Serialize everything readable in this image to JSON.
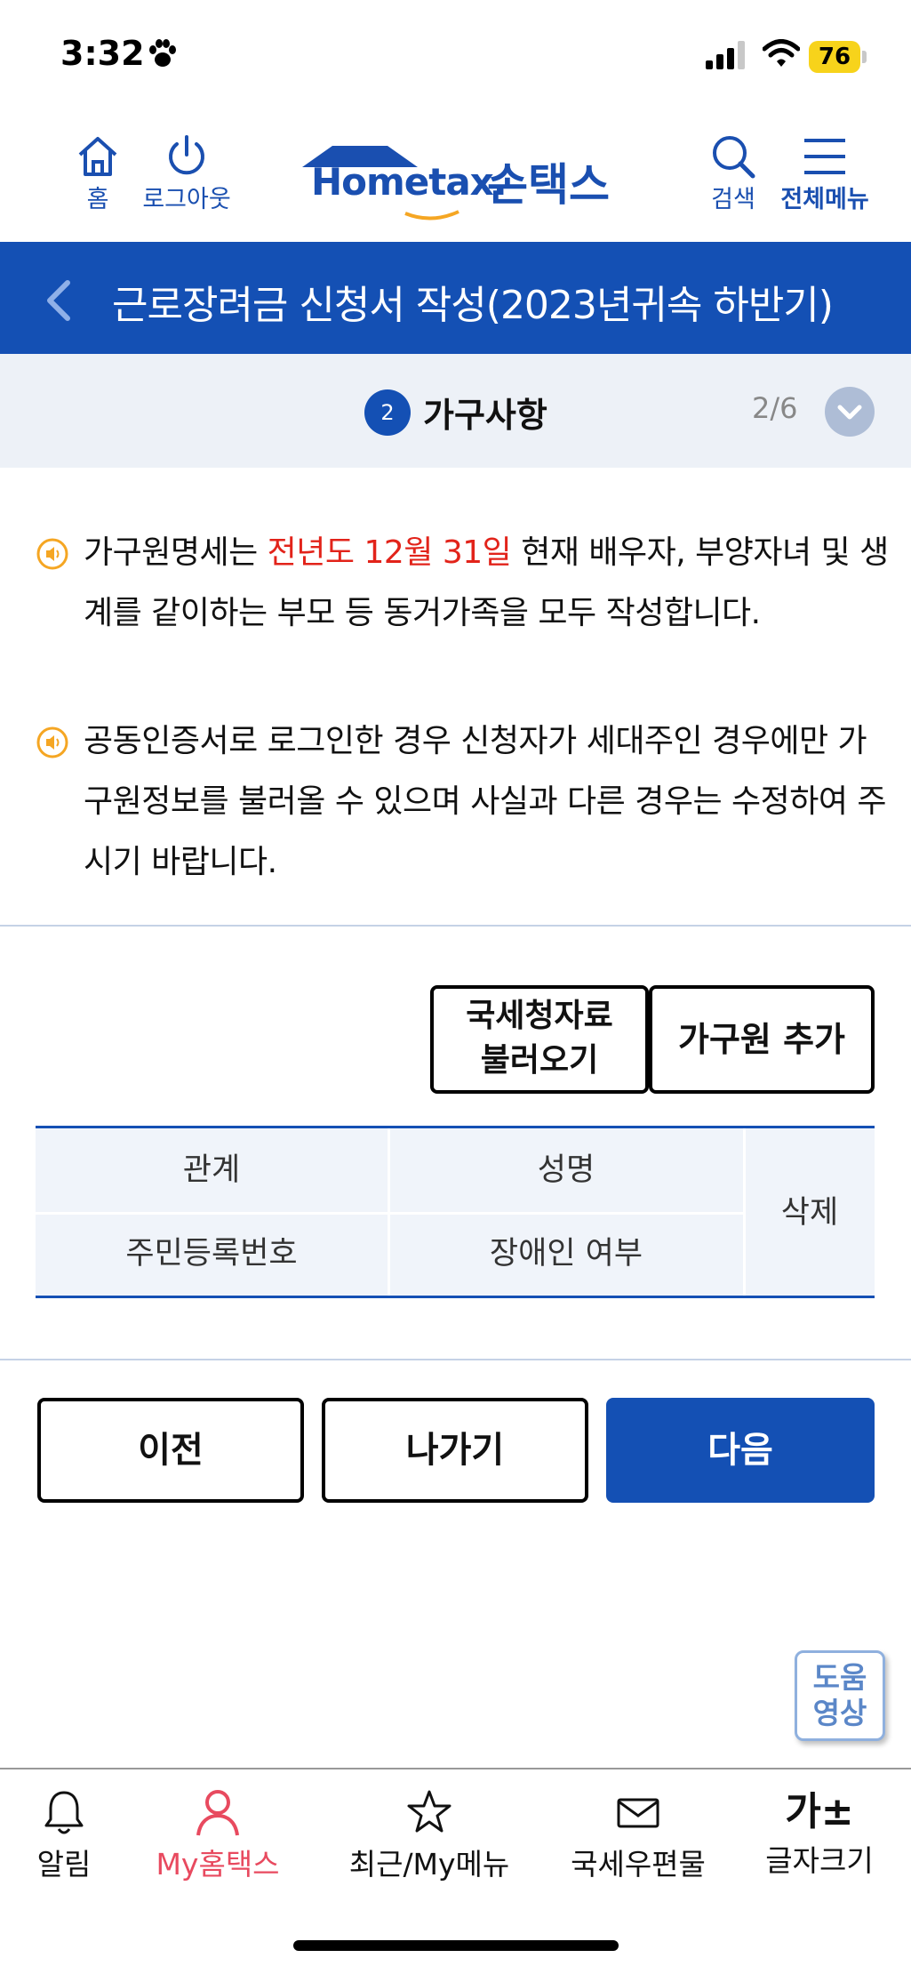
{
  "status_bar": {
    "time": "3:32",
    "battery": "76"
  },
  "header": {
    "home": "홈",
    "logout": "로그아웃",
    "logo_en": "Hometax.",
    "logo_kr": "손택스",
    "search": "검색",
    "menu": "전체메뉴"
  },
  "page": {
    "title": "근로장려금 신청서 작성(2023년귀속 하반기)"
  },
  "step": {
    "number": "2",
    "label": "가구사항",
    "count": "2/6"
  },
  "notices": [
    {
      "pre": "가구원명세는 ",
      "highlight": "전년도 12월 31일",
      "post": " 현재 배우자, 부양자녀 및 생계를 같이하는 부모 등 동거가족을 모두 작성합니다."
    },
    {
      "text": "공동인증서로 로그인한 경우 신청자가 세대주인 경우에만 가구원정보를 불러올 수 있으며 사실과 다른 경우는 수정하여 주시기 바랍니다."
    }
  ],
  "actions": {
    "load_line1": "국세청자료",
    "load_line2": "불러오기",
    "add": "가구원 추가"
  },
  "table": {
    "relation": "관계",
    "name": "성명",
    "delete": "삭제",
    "rrn": "주민등록번호",
    "disability": "장애인 여부"
  },
  "nav": {
    "prev": "이전",
    "exit": "나가기",
    "next": "다음"
  },
  "help": {
    "line1": "도움",
    "line2": "영상"
  },
  "tabbar": {
    "alert": "알림",
    "my": "My홈택스",
    "recent": "최근/My메뉴",
    "post": "국세우편물",
    "font_glyph": "가±",
    "font": "글자크기"
  },
  "colors": {
    "primary": "#1450b4",
    "highlight": "#e2231a",
    "my_tab": "#e84a5f"
  }
}
